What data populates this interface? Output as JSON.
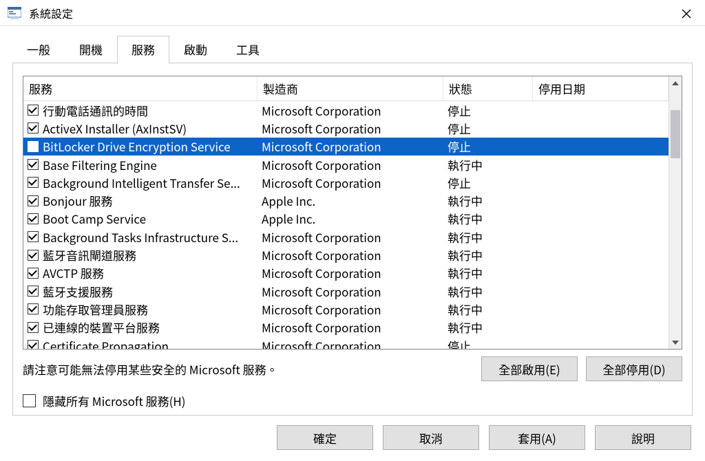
{
  "window": {
    "title": "系統設定"
  },
  "tabs": [
    {
      "label": "一般",
      "active": false
    },
    {
      "label": "開機",
      "active": false
    },
    {
      "label": "服務",
      "active": true
    },
    {
      "label": "啟動",
      "active": false
    },
    {
      "label": "工具",
      "active": false
    }
  ],
  "columns": {
    "service": "服務",
    "manufacturer": "製造商",
    "status": "狀態",
    "date_disabled": "停用日期"
  },
  "services": [
    {
      "checked": true,
      "name": "行動電話通訊的時間",
      "manufacturer": "Microsoft Corporation",
      "status": "停止",
      "date": "",
      "selected": false
    },
    {
      "checked": true,
      "name": "ActiveX Installer (AxInstSV)",
      "manufacturer": "Microsoft Corporation",
      "status": "停止",
      "date": "",
      "selected": false
    },
    {
      "checked": false,
      "name": "BitLocker Drive Encryption Service",
      "manufacturer": "Microsoft Corporation",
      "status": "停止",
      "date": "",
      "selected": true
    },
    {
      "checked": true,
      "name": "Base Filtering Engine",
      "manufacturer": "Microsoft Corporation",
      "status": "執行中",
      "date": "",
      "selected": false
    },
    {
      "checked": true,
      "name": "Background Intelligent Transfer Se...",
      "manufacturer": "Microsoft Corporation",
      "status": "停止",
      "date": "",
      "selected": false
    },
    {
      "checked": true,
      "name": "Bonjour 服務",
      "manufacturer": "Apple Inc.",
      "status": "執行中",
      "date": "",
      "selected": false
    },
    {
      "checked": true,
      "name": "Boot Camp Service",
      "manufacturer": "Apple Inc.",
      "status": "執行中",
      "date": "",
      "selected": false
    },
    {
      "checked": true,
      "name": "Background Tasks Infrastructure S...",
      "manufacturer": "Microsoft Corporation",
      "status": "執行中",
      "date": "",
      "selected": false
    },
    {
      "checked": true,
      "name": "藍牙音訊閘道服務",
      "manufacturer": "Microsoft Corporation",
      "status": "執行中",
      "date": "",
      "selected": false
    },
    {
      "checked": true,
      "name": "AVCTP 服務",
      "manufacturer": "Microsoft Corporation",
      "status": "執行中",
      "date": "",
      "selected": false
    },
    {
      "checked": true,
      "name": "藍牙支援服務",
      "manufacturer": "Microsoft Corporation",
      "status": "執行中",
      "date": "",
      "selected": false
    },
    {
      "checked": true,
      "name": "功能存取管理員服務",
      "manufacturer": "Microsoft Corporation",
      "status": "執行中",
      "date": "",
      "selected": false
    },
    {
      "checked": true,
      "name": "已連線的裝置平台服務",
      "manufacturer": "Microsoft Corporation",
      "status": "執行中",
      "date": "",
      "selected": false
    },
    {
      "checked": true,
      "name": "Certificate Propagation",
      "manufacturer": "Microsoft Corporation",
      "status": "停止",
      "date": "",
      "selected": false
    }
  ],
  "note": "請注意可能無法停用某些安全的 Microsoft 服務。",
  "buttons": {
    "enable_all": "全部啟用(E)",
    "disable_all": "全部停用(D)",
    "ok": "確定",
    "cancel": "取消",
    "apply": "套用(A)",
    "help": "說明"
  },
  "hide_ms": {
    "checked": false,
    "label": "隱藏所有 Microsoft 服務(H)"
  }
}
